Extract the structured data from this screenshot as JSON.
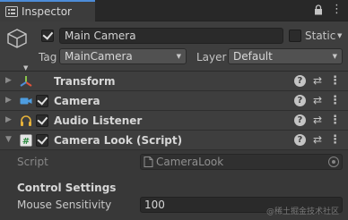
{
  "tab": {
    "label": "Inspector",
    "icon": "info-icon"
  },
  "tab_actions": [
    "lock-icon",
    "more-menu-icon"
  ],
  "header": {
    "name": "Main Camera",
    "active": true,
    "static_label": "Static",
    "static_checked": false,
    "tag_label": "Tag",
    "tag_value": "MainCamera",
    "layer_label": "Layer",
    "layer_value": "Default"
  },
  "components": [
    {
      "name": "Transform",
      "icon": "transform-axes-icon",
      "has_checkbox": false,
      "expanded": false
    },
    {
      "name": "Camera",
      "icon": "camera-icon",
      "has_checkbox": true,
      "enabled": true,
      "expanded": false
    },
    {
      "name": "Audio Listener",
      "icon": "headphones-icon",
      "has_checkbox": true,
      "enabled": true,
      "expanded": false
    },
    {
      "name": "Camera Look (Script)",
      "icon": "script-hash-icon",
      "has_checkbox": true,
      "enabled": true,
      "expanded": true
    }
  ],
  "script_component": {
    "script_label": "Script",
    "script_value": "CameraLook",
    "section_header": "Control Settings",
    "sensitivity_label": "Mouse Sensitivity",
    "sensitivity_value": "100"
  },
  "watermark": "@稀土掘金技术社区",
  "colors": {
    "accent": "#4d8cd8",
    "panel": "#3e3e3e",
    "background": "#383838"
  }
}
